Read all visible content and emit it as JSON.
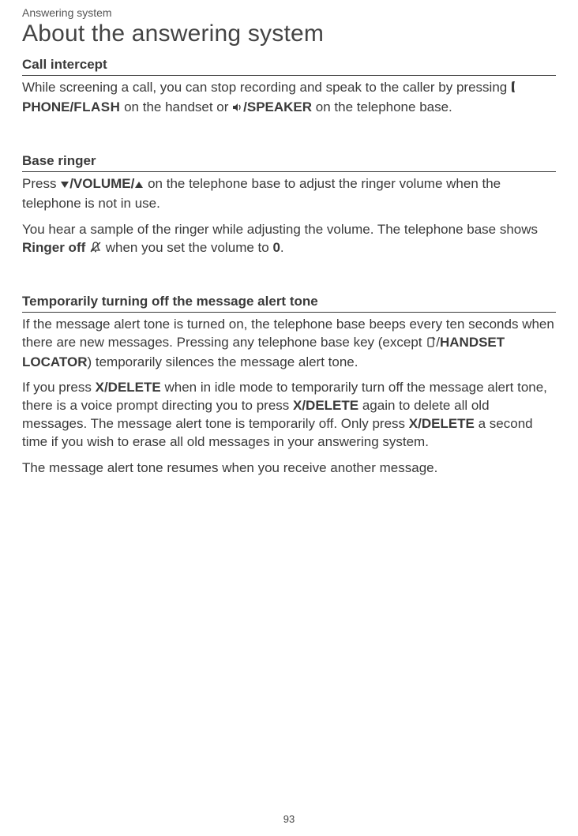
{
  "breadcrumb": "Answering system",
  "title": "About the answering system",
  "sections": {
    "call_intercept": {
      "heading": "Call intercept",
      "p1a": "While screening a call, you can stop recording and speak to the caller by pressing ",
      "phone_flash": "PHONE/",
      "flash_small": "FLASH",
      "p1b": " on the handset or ",
      "speaker": "/SPEAKER",
      "p1c": " on the telephone base."
    },
    "base_ringer": {
      "heading": "Base ringer",
      "p1a": "Press ",
      "vol_label": "/VOLUME/",
      "p1b": " on the telephone base to adjust the ringer volume when the telephone is not in use.",
      "p2a": "You hear a sample of the ringer while adjusting the volume. The telephone base shows ",
      "ringer_off": "Ringer off",
      "p2b": " when you set the volume to ",
      "zero": "0",
      "p2c": "."
    },
    "alert_tone": {
      "heading": "Temporarily turning off the message alert tone",
      "p1a": "If the message alert tone is turned on, the telephone base beeps every ten seconds when there are new messages. Pressing any telephone base key (except ",
      "handset_locator": "HANDSET LOCATOR",
      "p1b": ") temporarily silences the message alert tone.",
      "p2a": "If you press ",
      "xdel": "X/DELETE",
      "p2b": " when in idle mode to temporarily turn off the message alert tone, there is a voice prompt directing you to press ",
      "p2c": " again to delete all old messages. The message alert tone is temporarily off. Only press ",
      "p2d": " a second time if you wish to erase all old messages in your answering system.",
      "p3": "The message alert tone resumes when you receive another message."
    }
  },
  "page_number": "93"
}
